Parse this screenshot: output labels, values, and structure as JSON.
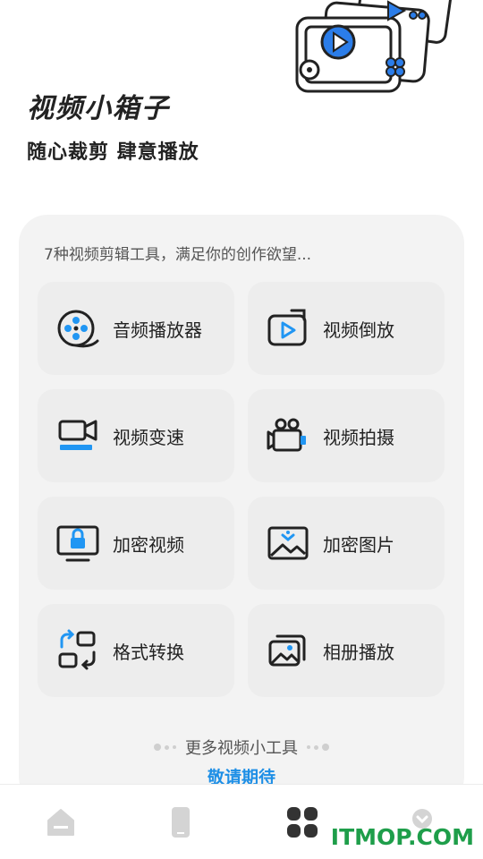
{
  "header": {
    "title": "视频小箱子",
    "slogan": "随心裁剪  肆意播放"
  },
  "panel": {
    "description": "7种视频剪辑工具，满足你的创作欲望...",
    "tools": [
      {
        "label": "音频播放器",
        "icon": "audio-reel-icon"
      },
      {
        "label": "视频倒放",
        "icon": "video-reverse-icon"
      },
      {
        "label": "视频变速",
        "icon": "video-speed-icon"
      },
      {
        "label": "视频拍摄",
        "icon": "video-camera-icon"
      },
      {
        "label": "加密视频",
        "icon": "locked-monitor-icon"
      },
      {
        "label": "加密图片",
        "icon": "locked-image-icon"
      },
      {
        "label": "格式转换",
        "icon": "format-convert-icon"
      },
      {
        "label": "相册播放",
        "icon": "album-icon"
      }
    ],
    "more_text": "更多视频小工具",
    "coming_soon": "敬请期待"
  },
  "bottom_nav": {
    "items": [
      {
        "icon": "home-icon",
        "active": false
      },
      {
        "icon": "phone-icon",
        "active": false
      },
      {
        "icon": "apps-grid-icon",
        "active": true
      },
      {
        "icon": "profile-icon",
        "active": false
      }
    ]
  },
  "watermark": "ITMOP.COM",
  "colors": {
    "accent": "#1e8fe6",
    "text": "#222222",
    "panel_bg": "#f3f3f3",
    "card_bg": "#ededed",
    "nav_active": "#333333",
    "nav_inactive": "#d0d0d0",
    "watermark": "#1e9e4a"
  }
}
